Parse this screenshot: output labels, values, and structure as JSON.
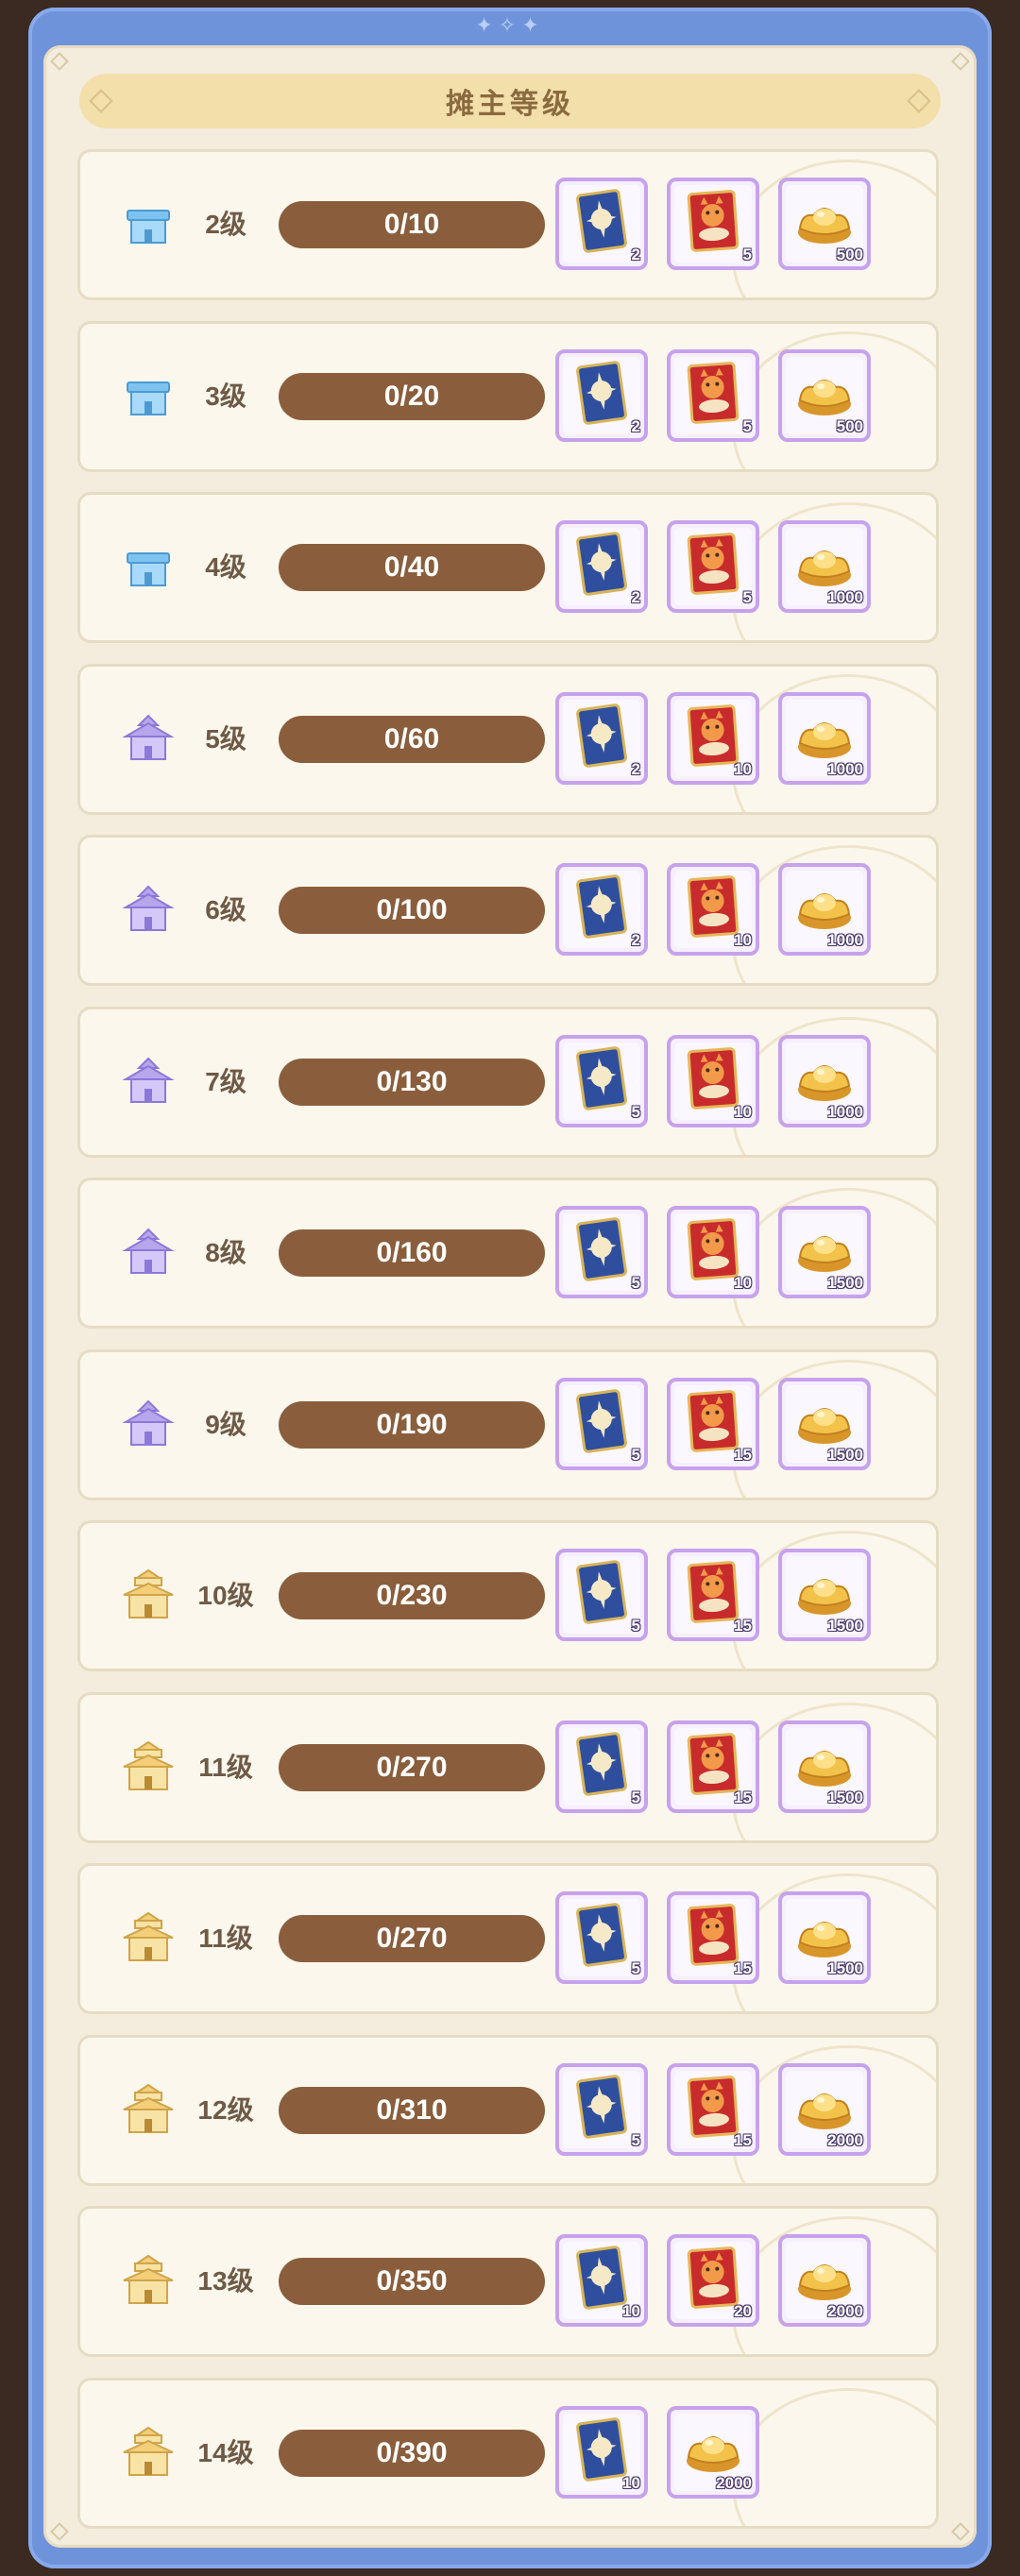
{
  "panel": {
    "title": "摊主等级"
  },
  "rows": [
    {
      "level": "2级",
      "tier": "blue",
      "progress": "0/10",
      "rewards": [
        {
          "type": "blue-card",
          "count": "2"
        },
        {
          "type": "red-card",
          "count": "5"
        },
        {
          "type": "gold-ingot",
          "count": "500"
        }
      ]
    },
    {
      "level": "3级",
      "tier": "blue",
      "progress": "0/20",
      "rewards": [
        {
          "type": "blue-card",
          "count": "2"
        },
        {
          "type": "red-card",
          "count": "5"
        },
        {
          "type": "gold-ingot",
          "count": "500"
        }
      ]
    },
    {
      "level": "4级",
      "tier": "blue",
      "progress": "0/40",
      "rewards": [
        {
          "type": "blue-card",
          "count": "2"
        },
        {
          "type": "red-card",
          "count": "5"
        },
        {
          "type": "gold-ingot",
          "count": "1000"
        }
      ]
    },
    {
      "level": "5级",
      "tier": "purple",
      "progress": "0/60",
      "rewards": [
        {
          "type": "blue-card",
          "count": "2"
        },
        {
          "type": "red-card",
          "count": "10"
        },
        {
          "type": "gold-ingot",
          "count": "1000"
        }
      ]
    },
    {
      "level": "6级",
      "tier": "purple",
      "progress": "0/100",
      "rewards": [
        {
          "type": "blue-card",
          "count": "2"
        },
        {
          "type": "red-card",
          "count": "10"
        },
        {
          "type": "gold-ingot",
          "count": "1000"
        }
      ]
    },
    {
      "level": "7级",
      "tier": "purple",
      "progress": "0/130",
      "rewards": [
        {
          "type": "blue-card",
          "count": "5"
        },
        {
          "type": "red-card",
          "count": "10"
        },
        {
          "type": "gold-ingot",
          "count": "1000"
        }
      ]
    },
    {
      "level": "8级",
      "tier": "purple",
      "progress": "0/160",
      "rewards": [
        {
          "type": "blue-card",
          "count": "5"
        },
        {
          "type": "red-card",
          "count": "10"
        },
        {
          "type": "gold-ingot",
          "count": "1500"
        }
      ]
    },
    {
      "level": "9级",
      "tier": "purple",
      "progress": "0/190",
      "rewards": [
        {
          "type": "blue-card",
          "count": "5"
        },
        {
          "type": "red-card",
          "count": "15"
        },
        {
          "type": "gold-ingot",
          "count": "1500"
        }
      ]
    },
    {
      "level": "10级",
      "tier": "gold",
      "progress": "0/230",
      "rewards": [
        {
          "type": "blue-card",
          "count": "5"
        },
        {
          "type": "red-card",
          "count": "15"
        },
        {
          "type": "gold-ingot",
          "count": "1500"
        }
      ]
    },
    {
      "level": "11级",
      "tier": "gold",
      "progress": "0/270",
      "rewards": [
        {
          "type": "blue-card",
          "count": "5"
        },
        {
          "type": "red-card",
          "count": "15"
        },
        {
          "type": "gold-ingot",
          "count": "1500"
        }
      ]
    },
    {
      "level": "11级",
      "tier": "gold",
      "progress": "0/270",
      "rewards": [
        {
          "type": "blue-card",
          "count": "5"
        },
        {
          "type": "red-card",
          "count": "15"
        },
        {
          "type": "gold-ingot",
          "count": "1500"
        }
      ]
    },
    {
      "level": "12级",
      "tier": "gold",
      "progress": "0/310",
      "rewards": [
        {
          "type": "blue-card",
          "count": "5"
        },
        {
          "type": "red-card",
          "count": "15"
        },
        {
          "type": "gold-ingot",
          "count": "2000"
        }
      ]
    },
    {
      "level": "13级",
      "tier": "gold",
      "progress": "0/350",
      "rewards": [
        {
          "type": "blue-card",
          "count": "10"
        },
        {
          "type": "red-card",
          "count": "20"
        },
        {
          "type": "gold-ingot",
          "count": "2000"
        }
      ]
    },
    {
      "level": "14级",
      "tier": "gold",
      "progress": "0/390",
      "rewards": [
        {
          "type": "blue-card",
          "count": "10"
        },
        {
          "type": "gold-ingot",
          "count": "2000"
        }
      ]
    }
  ],
  "progress_fraction": 0,
  "colors": {
    "frame": "#6f93db",
    "panel": "#f4eddd",
    "progress_track": "#8a5e3c",
    "reward_border": "#c7a2ec",
    "tier_blue": "#7ec3f0",
    "tier_purple": "#b7a6ec",
    "tier_gold": "#f3cf7a"
  }
}
